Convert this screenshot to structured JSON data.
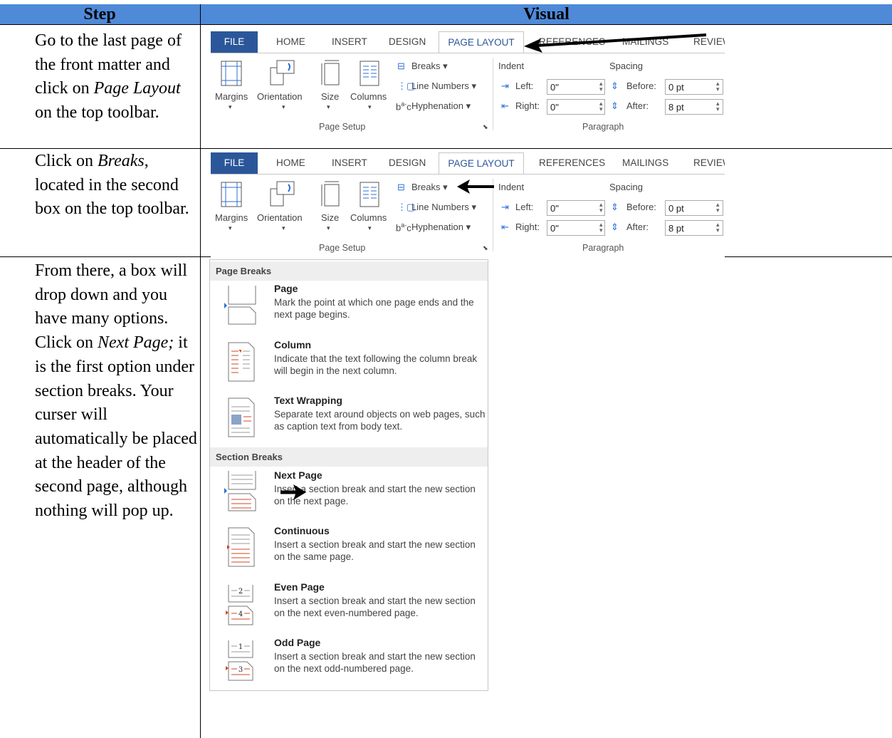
{
  "table": {
    "header_step": "Step",
    "header_visual": "Visual"
  },
  "rows": [
    {
      "step_html_parts": [
        "Go to the last page of the front matter and click on ",
        "Page Layout",
        " on the top toolbar."
      ]
    },
    {
      "step_html_parts": [
        "Click on ",
        "Breaks",
        ", located in the second box on the top toolbar."
      ]
    },
    {
      "step_html_parts": [
        "From there, a box will drop down and you have many options.  Click on ",
        "Next Page;",
        " it is the first option under section breaks.  Your curser will automatically be placed at the header of the second page, although nothing will pop up."
      ]
    }
  ],
  "ribbon": {
    "tabs": [
      "FILE",
      "HOME",
      "INSERT",
      "DESIGN",
      "PAGE LAYOUT",
      "REFERENCES",
      "MAILINGS",
      "REVIEW"
    ],
    "buttons": {
      "margins": "Margins",
      "orientation": "Orientation",
      "size": "Size",
      "columns": "Columns",
      "breaks": "Breaks",
      "line_numbers": "Line Numbers",
      "hyphenation": "Hyphenation"
    },
    "indent": {
      "label": "Indent",
      "left_label": "Left:",
      "left_value": "0\"",
      "right_label": "Right:",
      "right_value": "0\""
    },
    "spacing": {
      "label": "Spacing",
      "before_label": "Before:",
      "before_value": "0 pt",
      "after_label": "After:",
      "after_value": "8 pt"
    },
    "groups": {
      "page_setup": "Page Setup",
      "paragraph": "Paragraph"
    }
  },
  "menu": {
    "page_breaks_header": "Page Breaks",
    "section_breaks_header": "Section Breaks",
    "items": [
      {
        "title": "Page",
        "desc": "Mark the point at which one page ends and the next page begins."
      },
      {
        "title": "Column",
        "desc": "Indicate that the text following the column break will begin in the next column."
      },
      {
        "title": "Text Wrapping",
        "desc": "Separate text around objects on web pages, such as caption text from body text."
      },
      {
        "title": "Next Page",
        "desc": "Insert a section break and start the new section on the next page."
      },
      {
        "title": "Continuous",
        "desc": "Insert a section break and start the new section on the same page."
      },
      {
        "title": "Even Page",
        "desc": "Insert a section break and start the new section on the next even-numbered page."
      },
      {
        "title": "Odd Page",
        "desc": "Insert a section break and start the new section on the next odd-numbered page."
      }
    ],
    "icon_numbers": {
      "even_top": "2",
      "even_bottom": "4",
      "odd_top": "1",
      "odd_bottom": "3"
    }
  },
  "colors": {
    "header_bg": "#4f8ad8",
    "file_tab": "#2b579a",
    "accent_red": "#d24726"
  }
}
